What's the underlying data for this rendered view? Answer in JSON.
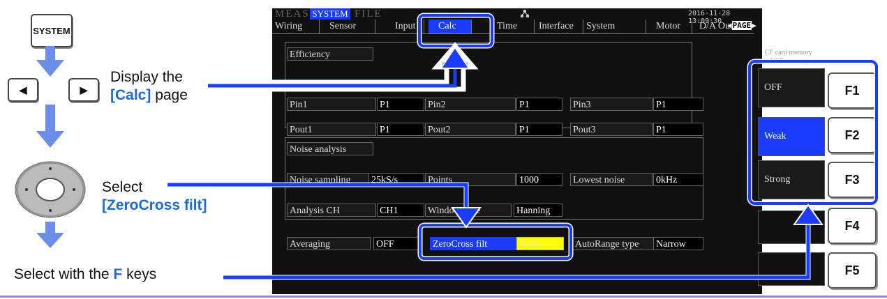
{
  "instructions": {
    "system_key": "SYSTEM",
    "left_arrow": "◀",
    "right_arrow": "▶",
    "step1_line1": "Display the",
    "step1_line2": "[Calc]",
    "step1_line3": " page",
    "step2_line1": "Select",
    "step2_line2": "[ZeroCross filt]",
    "step3_pre": "Select with the ",
    "step3_key": "F",
    "step3_post": " keys"
  },
  "screen": {
    "mode_tabs": [
      "MEAS",
      "SYSTEM",
      "FILE"
    ],
    "datetime": "2016-11-28 13:09:30",
    "page_label": "PAGE",
    "tabs": [
      "Wiring",
      "Sensor",
      "Input",
      "Calc",
      "Time",
      "Interface",
      "System",
      "Motor",
      "D/A Out"
    ],
    "cf_card": "CF card memory",
    "usb_mem": "USB memory",
    "efficiency": {
      "title": "Efficiency",
      "row1": [
        "Pin1",
        "P1",
        "Pin2",
        "P1",
        "Pin3",
        "P1"
      ],
      "row2": [
        "Pout1",
        "P1",
        "Pout2",
        "P1",
        "Pout3",
        "P1"
      ]
    },
    "noise": {
      "title": "Noise analysis",
      "sampling_label": "Noise sampling",
      "sampling_value": "25kS/s",
      "points_label": "Points",
      "points_value": "1000",
      "lowest_label": "Lowest noise",
      "lowest_value": "0kHz",
      "ch_label": "Analysis CH",
      "ch_value": "CH1",
      "window_label": "Window type",
      "window_value": "Hanning"
    },
    "averaging_label": "Averaging",
    "averaging_value": "OFF",
    "zerocross_label": "ZeroCross filt",
    "zerocross_value": "Weak",
    "autorange_label": "AutoRange type",
    "autorange_value": "Narrow",
    "softkeys": [
      "OFF",
      "Weak",
      "Strong"
    ]
  },
  "fkeys": [
    "F1",
    "F2",
    "F3",
    "F4",
    "F5"
  ],
  "colors": {
    "accent": "#1a3cff",
    "highlight": "#1a3cff",
    "value_yellow": "#ffff00"
  }
}
